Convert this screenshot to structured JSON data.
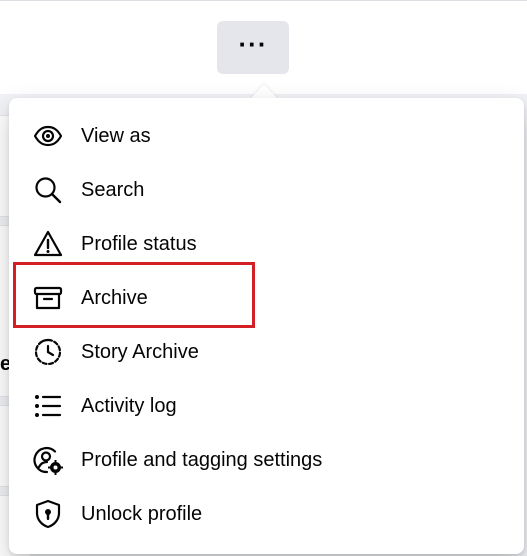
{
  "header": {
    "more_button_label": "···"
  },
  "background": {
    "peek_text": "er"
  },
  "menu": {
    "items": [
      {
        "label": "View as",
        "icon": "eye-icon"
      },
      {
        "label": "Search",
        "icon": "search-icon"
      },
      {
        "label": "Profile status",
        "icon": "warning-icon"
      },
      {
        "label": "Archive",
        "icon": "archive-box-icon"
      },
      {
        "label": "Story Archive",
        "icon": "story-archive-icon"
      },
      {
        "label": "Activity log",
        "icon": "list-icon"
      },
      {
        "label": "Profile and tagging settings",
        "icon": "profile-settings-icon"
      },
      {
        "label": "Unlock profile",
        "icon": "shield-lock-icon"
      }
    ]
  },
  "highlight": {
    "target": "Archive",
    "color": "#d32027"
  }
}
